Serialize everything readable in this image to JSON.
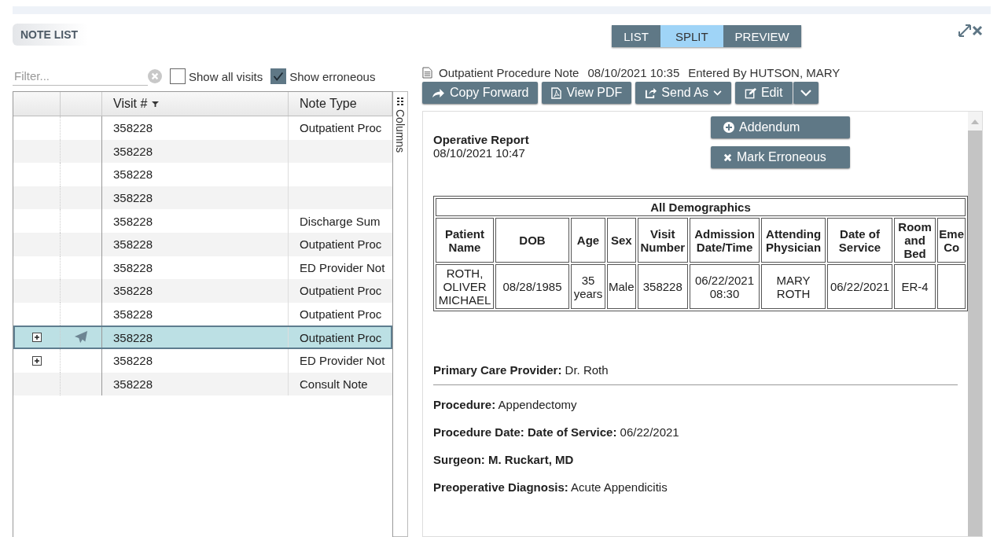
{
  "note_list": {
    "title": "NOTE LIST",
    "filter": {
      "placeholder": "Filter..."
    },
    "options": [
      {
        "label": "Show all visits",
        "checked": false
      },
      {
        "label": "Show erroneous",
        "checked": true
      }
    ],
    "columns": [
      "Visit #",
      "Note Type"
    ],
    "columns_tab": "Columns",
    "rows": [
      {
        "visit": "358228",
        "note_type": "Outpatient Proc",
        "expandable": false,
        "sent": false,
        "selected": false
      },
      {
        "visit": "358228",
        "expandable": false,
        "sent": false,
        "selected": false
      },
      {
        "visit": "358228",
        "expandable": false,
        "sent": false,
        "selected": false
      },
      {
        "visit": "358228",
        "expandable": false,
        "sent": false,
        "selected": false
      },
      {
        "visit": "358228",
        "note_type": "Discharge Sum",
        "expandable": false,
        "sent": false,
        "selected": false
      },
      {
        "visit": "358228",
        "note_type": "Outpatient Proc",
        "expandable": false,
        "sent": false,
        "selected": false
      },
      {
        "visit": "358228",
        "note_type": "ED Provider Not",
        "expandable": false,
        "sent": false,
        "selected": false
      },
      {
        "visit": "358228",
        "note_type": "Outpatient Proc",
        "expandable": false,
        "sent": false,
        "selected": false
      },
      {
        "visit": "358228",
        "note_type": "Outpatient Proc",
        "expandable": false,
        "sent": false,
        "selected": false
      },
      {
        "visit": "358228",
        "note_type": "Outpatient Proc",
        "expandable": true,
        "sent": true,
        "selected": true
      },
      {
        "visit": "358228",
        "note_type": "ED Provider Not",
        "expandable": true,
        "sent": false,
        "selected": false
      },
      {
        "visit": "358228",
        "note_type": "Consult Note",
        "expandable": false,
        "sent": false,
        "selected": false
      }
    ]
  },
  "view_modes": [
    {
      "label": "LIST",
      "selected": false
    },
    {
      "label": "SPLIT",
      "selected": true
    },
    {
      "label": "PREVIEW",
      "selected": false
    }
  ],
  "note_header": {
    "title": "Outpatient Procedure Note",
    "date": "08/10/2021 10:35",
    "entered_by": "Entered By HUTSON, MARY"
  },
  "toolbar": [
    {
      "label": "Copy Forward",
      "kind": "forward"
    },
    {
      "label": "View PDF",
      "kind": "pdf"
    },
    {
      "label": "Send As",
      "kind": "send"
    },
    {
      "label": "Edit",
      "kind": "edit"
    }
  ],
  "menu": [
    {
      "label": "Addendum",
      "kind": "add"
    },
    {
      "label": "Mark Erroneous",
      "kind": "remove"
    }
  ],
  "document": {
    "title": "Operative Report",
    "date": "08/10/2021 10:47",
    "demographics": {
      "caption": "All Demographics",
      "columns": [
        "Patient Name",
        "DOB",
        "Age",
        "Sex",
        "Visit Number",
        "Admission Date/Time",
        "Attending Physician",
        "Date of Service",
        "Room and Bed",
        "Eme Co"
      ],
      "row": [
        "ROTH, OLIVER MICHAEL",
        "08/28/1985",
        "35 years",
        "Male",
        "358228",
        "06/22/2021 08:30",
        "MARY ROTH",
        "06/22/2021",
        "ER-4"
      ]
    },
    "primary_care": "**Primary Care Provider:** Dr. Roth",
    "fields": [
      "**Procedure:** Appendectomy",
      "**Procedure Date: Date of Service:** 06/22/2021",
      "**Surgeon:  M. Ruckart, MD**",
      "**Preoperative Diagnosis:** Acute Appendicitis"
    ]
  }
}
